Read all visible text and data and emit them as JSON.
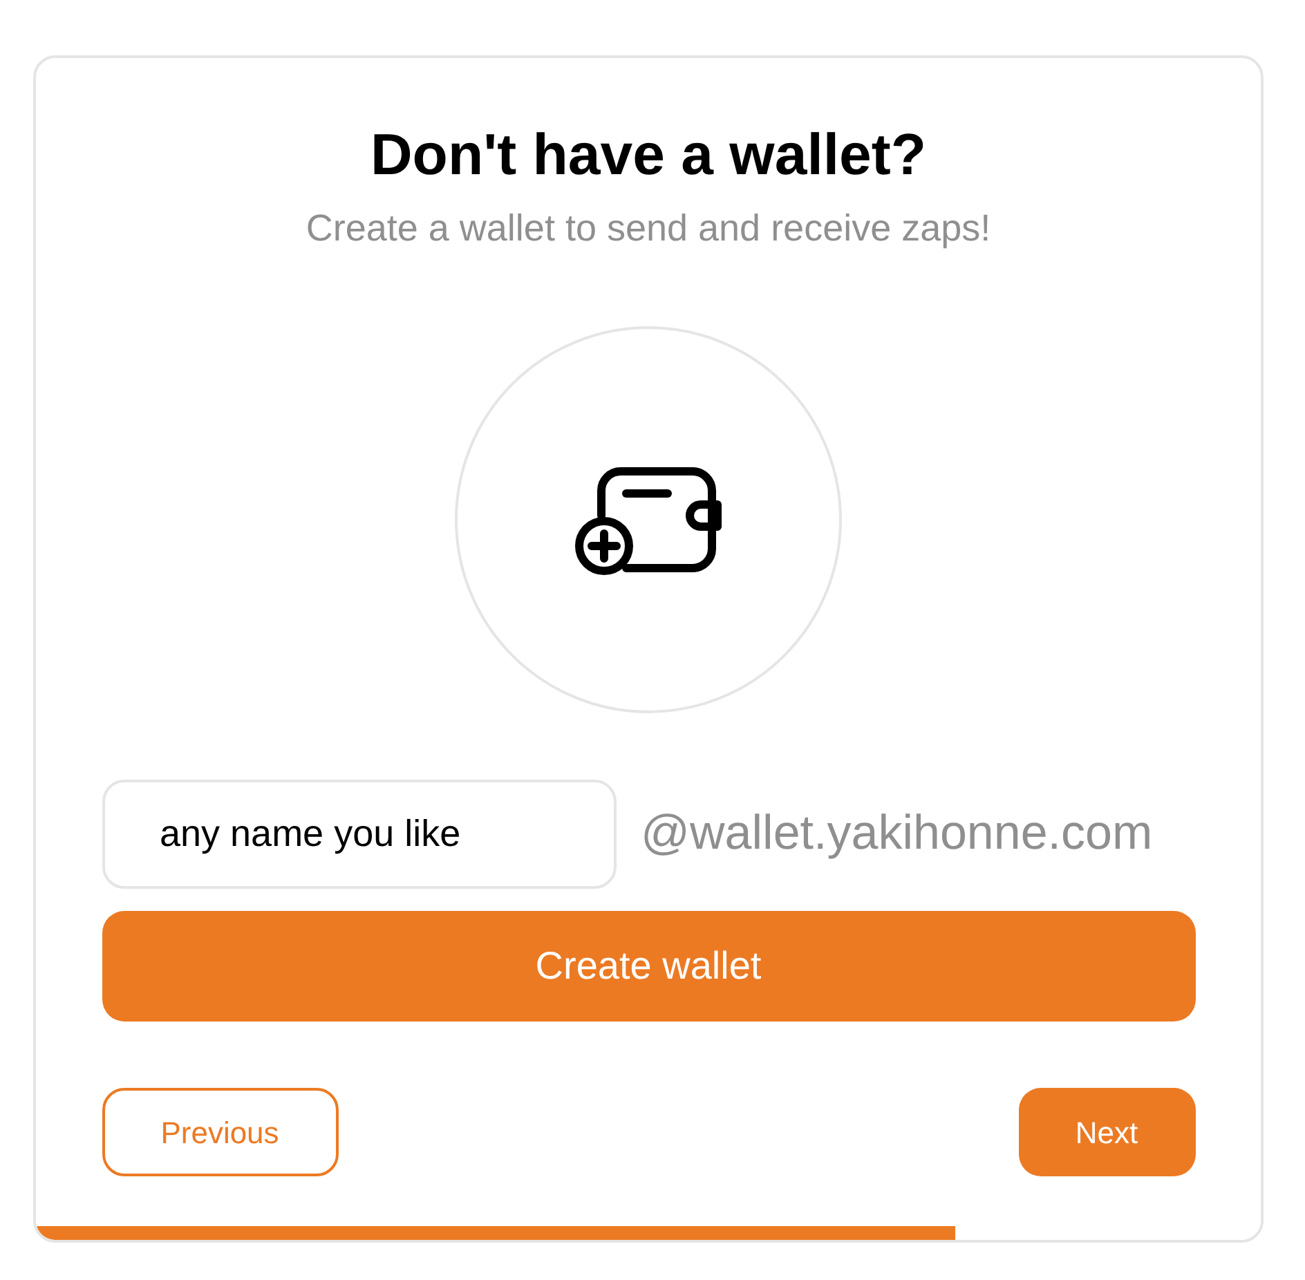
{
  "title": "Don't have a wallet?",
  "subtitle": "Create a wallet to send and receive zaps!",
  "name_field": {
    "value": "any name you like",
    "suffix": "@wallet.yakihonne.com"
  },
  "create_button": "Create wallet",
  "previous_button": "Previous",
  "next_button": "Next",
  "progress": {
    "level": 0.75
  }
}
